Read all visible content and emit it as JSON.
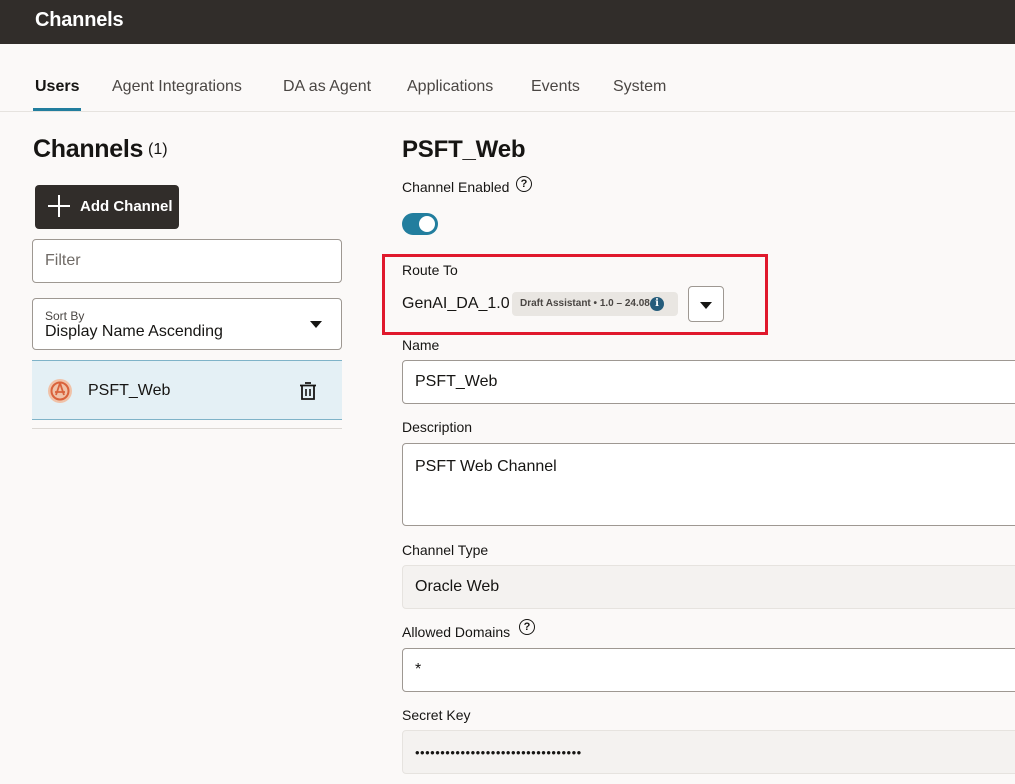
{
  "header": {
    "title": "Channels"
  },
  "tabs": [
    {
      "label": "Users",
      "active": true
    },
    {
      "label": "Agent Integrations"
    },
    {
      "label": "DA as Agent"
    },
    {
      "label": "Applications"
    },
    {
      "label": "Events"
    },
    {
      "label": "System"
    }
  ],
  "sidebar": {
    "title": "Channels",
    "count": "(1)",
    "add_button": "Add Channel",
    "filter_placeholder": "Filter",
    "sort": {
      "label": "Sort By",
      "value": "Display Name Ascending"
    },
    "items": [
      {
        "name": "PSFT_Web",
        "selected": true
      }
    ]
  },
  "detail": {
    "title": "PSFT_Web",
    "channel_enabled_label": "Channel Enabled",
    "channel_enabled": true,
    "route_to_label": "Route To",
    "route_to_value": "GenAI_DA_1.0",
    "route_badge": "Draft Assistant • 1.0 – 24.08",
    "name_label": "Name",
    "name_value": "PSFT_Web",
    "description_label": "Description",
    "description_value": "PSFT Web Channel",
    "channel_type_label": "Channel Type",
    "channel_type_value": "Oracle Web",
    "allowed_domains_label": "Allowed Domains",
    "allowed_domains_value": "*",
    "secret_key_label": "Secret Key",
    "secret_key_value": "•••••••••••••••••••••••••••••••••"
  },
  "colors": {
    "header_bg": "#312d2a",
    "accent": "#227e9e",
    "highlight_border": "#e0192c",
    "selected_row": "#e4f0f5"
  },
  "icons": [
    "plus-icon",
    "chevron-down-icon",
    "channel-web-icon",
    "trash-icon",
    "help-icon",
    "info-icon"
  ]
}
